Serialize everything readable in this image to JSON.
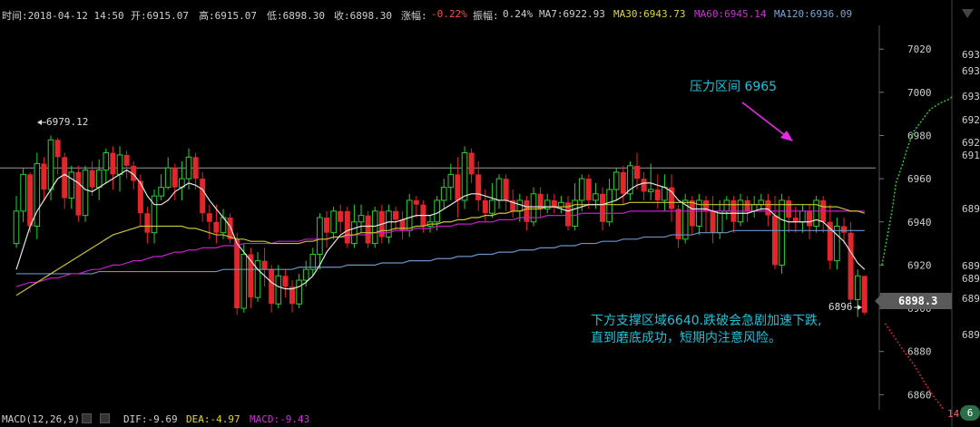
{
  "header": {
    "time": "时间:2018-04-12 14:50",
    "open": "开:6915.07",
    "high": "高:6915.07",
    "low": "低:6898.30",
    "close": "收:6898.30",
    "change_label": "涨幅:",
    "change_value": "-0.22%",
    "amplitude_label": "振幅:",
    "amplitude_value": "0.24%",
    "ma7": "MA7:6922.93",
    "ma30": "MA30:6943.73",
    "ma60": "MA60:6945.14",
    "ma120": "MA120:6936.09"
  },
  "footer": {
    "macd_label": "MACD(12,26,9)",
    "dif": "DIF:-9.69",
    "dea": "DEA:-4.97",
    "macd": "MACD:-9.43",
    "right_badge": "6",
    "right_bottom_number": "14.75"
  },
  "annotations": {
    "resistance": "压力区间 6965",
    "support_line1": "下方支撑区域6640.跌破会急剧加速下跌,",
    "support_line2": "直到磨底成功，短期内注意风险。",
    "high_marker": "6979.12",
    "low_marker": "6896",
    "price_tag": "6898.3"
  },
  "colors": {
    "up": "#2bd12b",
    "down": "#e3262b",
    "ma7": "#e6e6e6",
    "ma30": "#c9c236",
    "ma60": "#c21fc8",
    "ma120": "#6b93c4",
    "resistance_line": "#9a9a9a",
    "annotation": "#1fc1d7",
    "arrow": "#e828e8"
  },
  "right_panel_labels": [
    "693",
    "693",
    "693",
    "692",
    "692",
    "691",
    "689",
    "689",
    "689",
    "689",
    "689"
  ],
  "chart_data": {
    "type": "candlestick",
    "ylim": [
      6853,
      7031
    ],
    "yticks": [
      7020,
      7000,
      6980,
      6960,
      6940,
      6920,
      6900,
      6880,
      6860
    ],
    "resistance_level": 6965,
    "candles": [
      [
        6930,
        6945,
        6928,
        6952
      ],
      [
        6945,
        6962,
        6940,
        6965
      ],
      [
        6962,
        6938,
        6935,
        6963
      ],
      [
        6938,
        6967,
        6932,
        6972
      ],
      [
        6967,
        6955,
        6950,
        6970
      ],
      [
        6955,
        6978,
        6950,
        6980
      ],
      [
        6978,
        6970,
        6962,
        6979
      ],
      [
        6970,
        6951,
        6946,
        6972
      ],
      [
        6951,
        6963,
        6946,
        6966
      ],
      [
        6963,
        6943,
        6940,
        6966
      ],
      [
        6943,
        6964,
        6940,
        6966
      ],
      [
        6964,
        6956,
        6952,
        6968
      ],
      [
        6956,
        6964,
        6950,
        6969
      ],
      [
        6964,
        6972,
        6958,
        6974
      ],
      [
        6972,
        6962,
        6955,
        6975
      ],
      [
        6962,
        6971,
        6954,
        6975
      ],
      [
        6971,
        6966,
        6960,
        6973
      ],
      [
        6966,
        6959,
        6955,
        6968
      ],
      [
        6959,
        6944,
        6938,
        6962
      ],
      [
        6944,
        6935,
        6930,
        6947
      ],
      [
        6935,
        6952,
        6930,
        6955
      ],
      [
        6952,
        6956,
        6950,
        6962
      ],
      [
        6956,
        6965,
        6955,
        6970
      ],
      [
        6965,
        6956,
        6950,
        6967
      ],
      [
        6956,
        6960,
        6950,
        6968
      ],
      [
        6960,
        6970,
        6955,
        6974
      ],
      [
        6970,
        6960,
        6955,
        6972
      ],
      [
        6960,
        6944,
        6940,
        6963
      ],
      [
        6944,
        6940,
        6932,
        6948
      ],
      [
        6940,
        6935,
        6930,
        6948
      ],
      [
        6935,
        6942,
        6932,
        6946
      ],
      [
        6942,
        6932,
        6930,
        6944
      ],
      [
        6932,
        6900,
        6897,
        6935
      ],
      [
        6900,
        6925,
        6898,
        6930
      ],
      [
        6925,
        6905,
        6900,
        6928
      ],
      [
        6905,
        6922,
        6903,
        6926
      ],
      [
        6922,
        6918,
        6910,
        6928
      ],
      [
        6918,
        6902,
        6898,
        6920
      ],
      [
        6902,
        6915,
        6900,
        6920
      ],
      [
        6915,
        6910,
        6905,
        6918
      ],
      [
        6910,
        6902,
        6898,
        6913
      ],
      [
        6902,
        6913,
        6900,
        6916
      ],
      [
        6913,
        6918,
        6910,
        6922
      ],
      [
        6918,
        6925,
        6915,
        6928
      ],
      [
        6925,
        6942,
        6918,
        6944
      ],
      [
        6942,
        6935,
        6928,
        6945
      ],
      [
        6935,
        6945,
        6932,
        6947
      ],
      [
        6945,
        6940,
        6935,
        6948
      ],
      [
        6945,
        6930,
        6928,
        6947
      ],
      [
        6930,
        6940,
        6928,
        6948
      ],
      [
        6940,
        6943,
        6935,
        6948
      ],
      [
        6943,
        6930,
        6928,
        6945
      ],
      [
        6930,
        6945,
        6928,
        6947
      ],
      [
        6945,
        6933,
        6930,
        6948
      ],
      [
        6933,
        6945,
        6930,
        6948
      ],
      [
        6945,
        6941,
        6936,
        6947
      ],
      [
        6941,
        6936,
        6932,
        6945
      ],
      [
        6936,
        6950,
        6933,
        6953
      ],
      [
        6950,
        6948,
        6942,
        6952
      ],
      [
        6948,
        6938,
        6935,
        6950
      ],
      [
        6938,
        6940,
        6935,
        6943
      ],
      [
        6940,
        6950,
        6936,
        6952
      ],
      [
        6950,
        6956,
        6946,
        6960
      ],
      [
        6956,
        6962,
        6950,
        6967
      ],
      [
        6962,
        6950,
        6942,
        6970
      ],
      [
        6950,
        6972,
        6946,
        6975
      ],
      [
        6972,
        6962,
        6958,
        6974
      ],
      [
        6962,
        6950,
        6945,
        6968
      ],
      [
        6950,
        6944,
        6940,
        6955
      ],
      [
        6944,
        6950,
        6942,
        6958
      ],
      [
        6950,
        6960,
        6946,
        6962
      ],
      [
        6960,
        6950,
        6945,
        6962
      ],
      [
        6950,
        6945,
        6942,
        6955
      ],
      [
        6945,
        6950,
        6940,
        6953
      ],
      [
        6950,
        6940,
        6936,
        6952
      ],
      [
        6940,
        6953,
        6938,
        6956
      ],
      [
        6953,
        6946,
        6942,
        6956
      ],
      [
        6946,
        6950,
        6944,
        6953
      ],
      [
        6950,
        6947,
        6944,
        6953
      ],
      [
        6947,
        6949,
        6944,
        6952
      ],
      [
        6949,
        6938,
        6936,
        6952
      ],
      [
        6938,
        6950,
        6936,
        6958
      ],
      [
        6950,
        6960,
        6945,
        6962
      ],
      [
        6960,
        6950,
        6946,
        6962
      ],
      [
        6950,
        6953,
        6946,
        6958
      ],
      [
        6953,
        6940,
        6936,
        6956
      ],
      [
        6940,
        6955,
        6938,
        6960
      ],
      [
        6955,
        6963,
        6950,
        6965
      ],
      [
        6963,
        6953,
        6948,
        6966
      ],
      [
        6953,
        6966,
        6950,
        6968
      ],
      [
        6966,
        6960,
        6955,
        6972
      ],
      [
        6960,
        6954,
        6950,
        6963
      ],
      [
        6954,
        6955,
        6950,
        6967
      ],
      [
        6955,
        6950,
        6946,
        6962
      ],
      [
        6950,
        6956,
        6945,
        6962
      ],
      [
        6956,
        6946,
        6940,
        6962
      ],
      [
        6946,
        6932,
        6928,
        6948
      ],
      [
        6932,
        6950,
        6930,
        6953
      ],
      [
        6950,
        6938,
        6934,
        6952
      ],
      [
        6938,
        6950,
        6934,
        6953
      ],
      [
        6950,
        6945,
        6935,
        6952
      ],
      [
        6945,
        6935,
        6930,
        6952
      ],
      [
        6935,
        6945,
        6932,
        6950
      ],
      [
        6945,
        6950,
        6941,
        6952
      ],
      [
        6950,
        6940,
        6935,
        6952
      ],
      [
        6940,
        6950,
        6938,
        6953
      ],
      [
        6950,
        6945,
        6940,
        6952
      ],
      [
        6945,
        6948,
        6942,
        6952
      ],
      [
        6948,
        6950,
        6945,
        6953
      ],
      [
        6950,
        6943,
        6938,
        6953
      ],
      [
        6943,
        6920,
        6918,
        6952
      ],
      [
        6920,
        6950,
        6916,
        6953
      ],
      [
        6950,
        6942,
        6935,
        6952
      ],
      [
        6942,
        6940,
        6935,
        6947
      ],
      [
        6940,
        6945,
        6935,
        6948
      ],
      [
        6945,
        6938,
        6932,
        6948
      ],
      [
        6938,
        6950,
        6935,
        6952
      ],
      [
        6950,
        6940,
        6935,
        6952
      ],
      [
        6940,
        6922,
        6918,
        6948
      ],
      [
        6922,
        6938,
        6918,
        6942
      ],
      [
        6938,
        6935,
        6930,
        6942
      ],
      [
        6935,
        6904,
        6900,
        6940
      ],
      [
        6904,
        6915,
        6896,
        6918
      ],
      [
        6915,
        6898,
        6897,
        6915
      ]
    ],
    "ma7": [
      6918,
      6928,
      6938,
      6945,
      6950,
      6955,
      6960,
      6962,
      6960,
      6958,
      6955,
      6954,
      6956,
      6958,
      6960,
      6962,
      6964,
      6962,
      6958,
      6952,
      6948,
      6948,
      6950,
      6954,
      6956,
      6958,
      6957,
      6955,
      6950,
      6946,
      6942,
      6938,
      6930,
      6926,
      6922,
      6918,
      6915,
      6912,
      6910,
      6909,
      6909,
      6910,
      6912,
      6915,
      6920,
      6926,
      6930,
      6934,
      6936,
      6937,
      6938,
      6938,
      6938,
      6939,
      6940,
      6940,
      6941,
      6942,
      6943,
      6943,
      6943,
      6944,
      6946,
      6948,
      6950,
      6952,
      6953,
      6953,
      6952,
      6951,
      6950,
      6950,
      6949,
      6948,
      6947,
      6947,
      6947,
      6947,
      6947,
      6946,
      6945,
      6946,
      6947,
      6948,
      6948,
      6948,
      6949,
      6950,
      6952,
      6955,
      6957,
      6958,
      6958,
      6957,
      6956,
      6954,
      6950,
      6948,
      6946,
      6946,
      6946,
      6945,
      6944,
      6944,
      6944,
      6944,
      6944,
      6945,
      6946,
      6946,
      6943,
      6941,
      6940,
      6940,
      6940,
      6940,
      6941,
      6940,
      6937,
      6934,
      6931,
      6926,
      6921,
      6918
    ],
    "ma30": [
      6906,
      6908,
      6910,
      6912,
      6914,
      6916,
      6918,
      6920,
      6922,
      6924,
      6926,
      6928,
      6930,
      6932,
      6934,
      6935,
      6936,
      6937,
      6938,
      6938,
      6938,
      6938,
      6938,
      6938,
      6938,
      6937,
      6937,
      6936,
      6935,
      6934,
      6934,
      6933,
      6932,
      6932,
      6931,
      6931,
      6931,
      6930,
      6930,
      6930,
      6930,
      6930,
      6931,
      6931,
      6932,
      6932,
      6933,
      6933,
      6934,
      6934,
      6935,
      6935,
      6935,
      6936,
      6936,
      6937,
      6937,
      6937,
      6938,
      6938,
      6939,
      6939,
      6940,
      6940,
      6941,
      6941,
      6942,
      6942,
      6943,
      6943,
      6944,
      6944,
      6945,
      6945,
      6946,
      6946,
      6946,
      6947,
      6947,
      6947,
      6947,
      6948,
      6948,
      6948,
      6948,
      6948,
      6948,
      6948,
      6948,
      6949,
      6949,
      6949,
      6949,
      6949,
      6949,
      6949,
      6949,
      6949,
      6949,
      6948,
      6948,
      6948,
      6948,
      6948,
      6948,
      6948,
      6948,
      6948,
      6948,
      6948,
      6948,
      6948,
      6948,
      6948,
      6948,
      6948,
      6948,
      6947,
      6947,
      6947,
      6946,
      6945,
      6945,
      6944
    ],
    "ma60": [
      6910,
      6911,
      6912,
      6912,
      6913,
      6914,
      6914,
      6915,
      6916,
      6916,
      6917,
      6918,
      6918,
      6919,
      6920,
      6920,
      6921,
      6922,
      6922,
      6923,
      6924,
      6924,
      6925,
      6926,
      6926,
      6927,
      6927,
      6928,
      6928,
      6928,
      6929,
      6929,
      6929,
      6930,
      6930,
      6930,
      6930,
      6930,
      6931,
      6931,
      6931,
      6931,
      6932,
      6932,
      6932,
      6932,
      6933,
      6933,
      6933,
      6934,
      6934,
      6934,
      6935,
      6935,
      6935,
      6936,
      6936,
      6936,
      6937,
      6937,
      6937,
      6938,
      6938,
      6938,
      6939,
      6939,
      6939,
      6940,
      6940,
      6940,
      6941,
      6941,
      6941,
      6942,
      6942,
      6942,
      6942,
      6943,
      6943,
      6943,
      6943,
      6943,
      6944,
      6944,
      6944,
      6944,
      6944,
      6944,
      6944,
      6945,
      6945,
      6945,
      6945,
      6945,
      6945,
      6945,
      6945,
      6945,
      6945,
      6945,
      6945,
      6945,
      6945,
      6945,
      6945,
      6945,
      6945,
      6945,
      6945,
      6945,
      6945,
      6945,
      6945,
      6945,
      6945,
      6945,
      6945,
      6945,
      6945,
      6945,
      6945,
      6945,
      6945,
      6945
    ],
    "ma120": [
      6916,
      6916,
      6916,
      6916,
      6916,
      6916,
      6916,
      6916,
      6916,
      6916,
      6916,
      6916,
      6917,
      6917,
      6917,
      6917,
      6917,
      6917,
      6917,
      6917,
      6917,
      6917,
      6917,
      6917,
      6917,
      6917,
      6917,
      6917,
      6917,
      6917,
      6918,
      6918,
      6918,
      6918,
      6918,
      6918,
      6918,
      6918,
      6918,
      6918,
      6918,
      6919,
      6919,
      6919,
      6919,
      6919,
      6919,
      6919,
      6920,
      6920,
      6920,
      6920,
      6920,
      6921,
      6921,
      6921,
      6921,
      6922,
      6922,
      6922,
      6922,
      6923,
      6923,
      6923,
      6924,
      6924,
      6924,
      6925,
      6925,
      6925,
      6926,
      6926,
      6926,
      6927,
      6927,
      6927,
      6928,
      6928,
      6928,
      6929,
      6929,
      6929,
      6930,
      6930,
      6930,
      6931,
      6931,
      6931,
      6932,
      6932,
      6932,
      6933,
      6933,
      6933,
      6933,
      6934,
      6934,
      6934,
      6934,
      6935,
      6935,
      6935,
      6935,
      6935,
      6936,
      6936,
      6936,
      6936,
      6936,
      6936,
      6936,
      6936,
      6936,
      6936,
      6936,
      6936,
      6936,
      6936,
      6936,
      6936,
      6936,
      6936,
      6936,
      6936
    ],
    "projection_up": [
      [
        6972,
        6920
      ],
      [
        6976,
        6930
      ],
      [
        6982,
        6945
      ],
      [
        6986,
        6958
      ],
      [
        6992,
        6966
      ],
      [
        6998,
        6975
      ],
      [
        7004,
        6982
      ],
      [
        7012,
        6987
      ],
      [
        7020,
        6992
      ],
      [
        7030,
        6995
      ],
      [
        7040,
        6997
      ],
      [
        7048,
        7001
      ]
    ],
    "projection_down": [
      [
        6975,
        6893
      ],
      [
        6984,
        6887
      ],
      [
        6994,
        6880
      ],
      [
        7004,
        6874
      ],
      [
        7014,
        6866
      ],
      [
        7024,
        6859
      ],
      [
        7034,
        6853
      ]
    ]
  }
}
